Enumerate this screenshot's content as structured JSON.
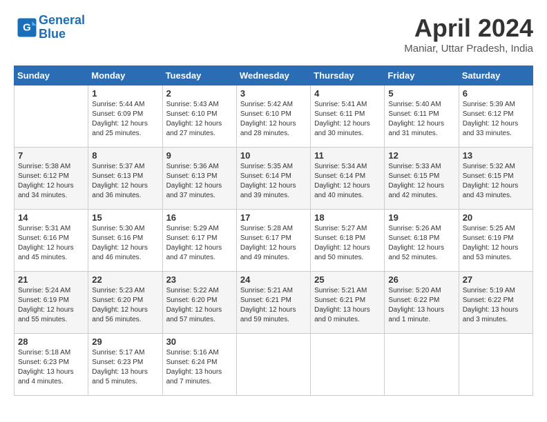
{
  "header": {
    "logo_line1": "General",
    "logo_line2": "Blue",
    "month": "April 2024",
    "location": "Maniar, Uttar Pradesh, India"
  },
  "weekdays": [
    "Sunday",
    "Monday",
    "Tuesday",
    "Wednesday",
    "Thursday",
    "Friday",
    "Saturday"
  ],
  "weeks": [
    [
      {
        "day": "",
        "text": ""
      },
      {
        "day": "1",
        "text": "Sunrise: 5:44 AM\nSunset: 6:09 PM\nDaylight: 12 hours\nand 25 minutes."
      },
      {
        "day": "2",
        "text": "Sunrise: 5:43 AM\nSunset: 6:10 PM\nDaylight: 12 hours\nand 27 minutes."
      },
      {
        "day": "3",
        "text": "Sunrise: 5:42 AM\nSunset: 6:10 PM\nDaylight: 12 hours\nand 28 minutes."
      },
      {
        "day": "4",
        "text": "Sunrise: 5:41 AM\nSunset: 6:11 PM\nDaylight: 12 hours\nand 30 minutes."
      },
      {
        "day": "5",
        "text": "Sunrise: 5:40 AM\nSunset: 6:11 PM\nDaylight: 12 hours\nand 31 minutes."
      },
      {
        "day": "6",
        "text": "Sunrise: 5:39 AM\nSunset: 6:12 PM\nDaylight: 12 hours\nand 33 minutes."
      }
    ],
    [
      {
        "day": "7",
        "text": "Sunrise: 5:38 AM\nSunset: 6:12 PM\nDaylight: 12 hours\nand 34 minutes."
      },
      {
        "day": "8",
        "text": "Sunrise: 5:37 AM\nSunset: 6:13 PM\nDaylight: 12 hours\nand 36 minutes."
      },
      {
        "day": "9",
        "text": "Sunrise: 5:36 AM\nSunset: 6:13 PM\nDaylight: 12 hours\nand 37 minutes."
      },
      {
        "day": "10",
        "text": "Sunrise: 5:35 AM\nSunset: 6:14 PM\nDaylight: 12 hours\nand 39 minutes."
      },
      {
        "day": "11",
        "text": "Sunrise: 5:34 AM\nSunset: 6:14 PM\nDaylight: 12 hours\nand 40 minutes."
      },
      {
        "day": "12",
        "text": "Sunrise: 5:33 AM\nSunset: 6:15 PM\nDaylight: 12 hours\nand 42 minutes."
      },
      {
        "day": "13",
        "text": "Sunrise: 5:32 AM\nSunset: 6:15 PM\nDaylight: 12 hours\nand 43 minutes."
      }
    ],
    [
      {
        "day": "14",
        "text": "Sunrise: 5:31 AM\nSunset: 6:16 PM\nDaylight: 12 hours\nand 45 minutes."
      },
      {
        "day": "15",
        "text": "Sunrise: 5:30 AM\nSunset: 6:16 PM\nDaylight: 12 hours\nand 46 minutes."
      },
      {
        "day": "16",
        "text": "Sunrise: 5:29 AM\nSunset: 6:17 PM\nDaylight: 12 hours\nand 47 minutes."
      },
      {
        "day": "17",
        "text": "Sunrise: 5:28 AM\nSunset: 6:17 PM\nDaylight: 12 hours\nand 49 minutes."
      },
      {
        "day": "18",
        "text": "Sunrise: 5:27 AM\nSunset: 6:18 PM\nDaylight: 12 hours\nand 50 minutes."
      },
      {
        "day": "19",
        "text": "Sunrise: 5:26 AM\nSunset: 6:18 PM\nDaylight: 12 hours\nand 52 minutes."
      },
      {
        "day": "20",
        "text": "Sunrise: 5:25 AM\nSunset: 6:19 PM\nDaylight: 12 hours\nand 53 minutes."
      }
    ],
    [
      {
        "day": "21",
        "text": "Sunrise: 5:24 AM\nSunset: 6:19 PM\nDaylight: 12 hours\nand 55 minutes."
      },
      {
        "day": "22",
        "text": "Sunrise: 5:23 AM\nSunset: 6:20 PM\nDaylight: 12 hours\nand 56 minutes."
      },
      {
        "day": "23",
        "text": "Sunrise: 5:22 AM\nSunset: 6:20 PM\nDaylight: 12 hours\nand 57 minutes."
      },
      {
        "day": "24",
        "text": "Sunrise: 5:21 AM\nSunset: 6:21 PM\nDaylight: 12 hours\nand 59 minutes."
      },
      {
        "day": "25",
        "text": "Sunrise: 5:21 AM\nSunset: 6:21 PM\nDaylight: 13 hours\nand 0 minutes."
      },
      {
        "day": "26",
        "text": "Sunrise: 5:20 AM\nSunset: 6:22 PM\nDaylight: 13 hours\nand 1 minute."
      },
      {
        "day": "27",
        "text": "Sunrise: 5:19 AM\nSunset: 6:22 PM\nDaylight: 13 hours\nand 3 minutes."
      }
    ],
    [
      {
        "day": "28",
        "text": "Sunrise: 5:18 AM\nSunset: 6:23 PM\nDaylight: 13 hours\nand 4 minutes."
      },
      {
        "day": "29",
        "text": "Sunrise: 5:17 AM\nSunset: 6:23 PM\nDaylight: 13 hours\nand 5 minutes."
      },
      {
        "day": "30",
        "text": "Sunrise: 5:16 AM\nSunset: 6:24 PM\nDaylight: 13 hours\nand 7 minutes."
      },
      {
        "day": "",
        "text": ""
      },
      {
        "day": "",
        "text": ""
      },
      {
        "day": "",
        "text": ""
      },
      {
        "day": "",
        "text": ""
      }
    ]
  ]
}
